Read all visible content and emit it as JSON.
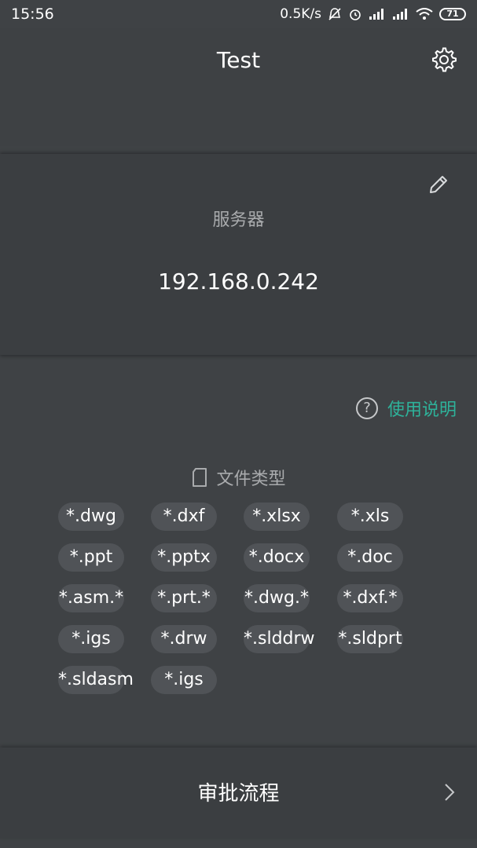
{
  "status_bar": {
    "time": "15:56",
    "speed": "0.5K/s",
    "battery": "71",
    "icons": [
      "mute-notification-icon",
      "alarm-icon",
      "signal-icon",
      "signal-icon",
      "wifi-icon",
      "battery-icon"
    ]
  },
  "header": {
    "title": "Test",
    "settings_icon": "gear-icon"
  },
  "server": {
    "label": "服务器",
    "address": "192.168.0.242",
    "edit_icon": "pencil-icon"
  },
  "help": {
    "icon": "question-circle-icon",
    "label": "使用说明",
    "color": "#2eb29a"
  },
  "file_types": {
    "heading_icon": "file-icon",
    "heading": "文件类型",
    "items": [
      "*.dwg",
      "*.dxf",
      "*.xlsx",
      "*.xls",
      "*.ppt",
      "*.pptx",
      "*.docx",
      "*.doc",
      "*.asm.*",
      "*.prt.*",
      "*.dwg.*",
      "*.dxf.*",
      "*.igs",
      "*.drw",
      "*.slddrw",
      "*.sldprt",
      "*.sldasm",
      "*.igs"
    ]
  },
  "approval": {
    "label": "审批流程",
    "chevron_icon": "chevron-right-icon"
  },
  "colors": {
    "background": "#3f4245",
    "card": "#3b3e41",
    "chip": "#505357",
    "accent": "#2eb29a"
  }
}
